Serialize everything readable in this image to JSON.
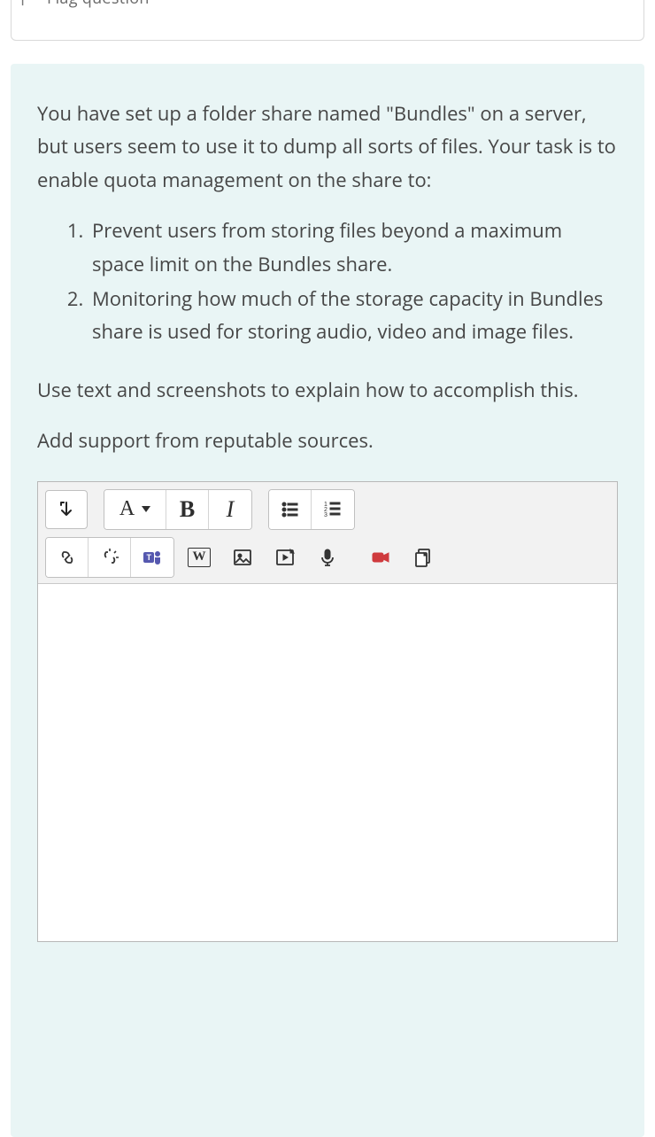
{
  "header": {
    "flag_label": "Flag question"
  },
  "question": {
    "intro": "You have set up a folder share named \"Bundles\" on a server, but users seem to use it to dump all sorts of files. Your task is to enable quota management on the share to:",
    "items": [
      "Prevent users from storing files beyond a maximum space limit on the Bundles share.",
      "Monitoring how much of the storage capacity in Bundles share is used for storing audio, video and image files."
    ],
    "outro1": "Use text and screenshots to explain how to accomplish this.",
    "outro2": "Add support from reputable sources."
  },
  "toolbar": {
    "font_label": "A",
    "bold_label": "B",
    "italic_label": "I",
    "word_label": "W"
  },
  "colors": {
    "panel_bg": "#e9f5f5",
    "accent_red": "#cf3a3d",
    "accent_purple": "#5558af"
  }
}
